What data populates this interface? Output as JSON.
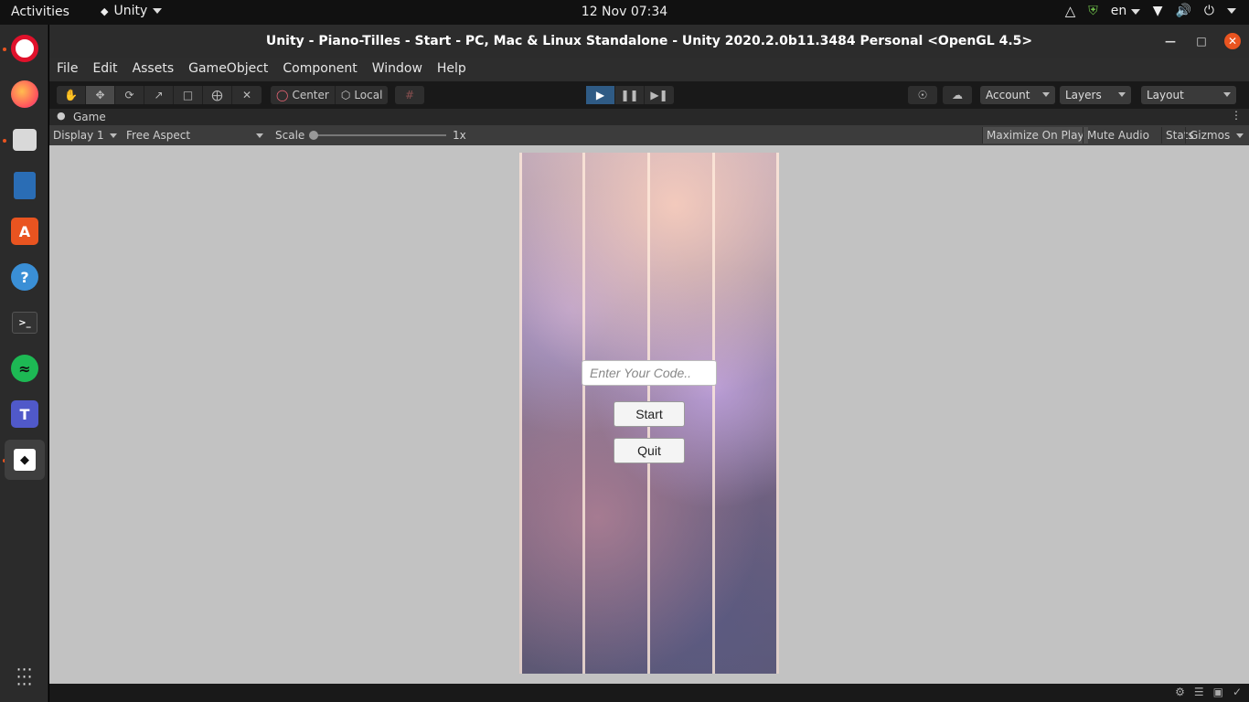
{
  "topbar": {
    "activities": "Activities",
    "app_name": "Unity",
    "clock": "12 Nov  07:34",
    "language": "en"
  },
  "dock": {
    "items": [
      {
        "name": "opera",
        "color": "#e0112b"
      },
      {
        "name": "firefox",
        "color": "#ff7139"
      },
      {
        "name": "files",
        "color": "#d9d9d9"
      },
      {
        "name": "libreoffice-writer",
        "color": "#2a6db5"
      },
      {
        "name": "ubuntu-software",
        "color": "#e95420"
      },
      {
        "name": "help",
        "color": "#3a8fd6"
      },
      {
        "name": "terminal",
        "color": "#333333"
      },
      {
        "name": "spotify",
        "color": "#1db954"
      },
      {
        "name": "teams",
        "color": "#5059c9"
      },
      {
        "name": "unity",
        "color": "#111111"
      }
    ]
  },
  "window": {
    "title": "Unity - Piano-Tilles - Start - PC, Mac & Linux Standalone - Unity 2020.2.0b11.3484 Personal <OpenGL 4.5>"
  },
  "menubar": {
    "items": [
      "File",
      "Edit",
      "Assets",
      "GameObject",
      "Component",
      "Window",
      "Help"
    ]
  },
  "toolbar": {
    "pivot": "Center",
    "space": "Local",
    "account": "Account",
    "layers": "Layers",
    "layout": "Layout"
  },
  "game_tab": {
    "label": "Game"
  },
  "game_bar": {
    "display": "Display 1",
    "aspect": "Free Aspect",
    "scale_label": "Scale",
    "scale_value": "1x",
    "maximize": "Maximize On Play",
    "mute": "Mute Audio",
    "stats": "Stats",
    "gizmos": "Gizmos"
  },
  "game": {
    "code_placeholder": "Enter Your Code..",
    "start_label": "Start",
    "quit_label": "Quit"
  }
}
